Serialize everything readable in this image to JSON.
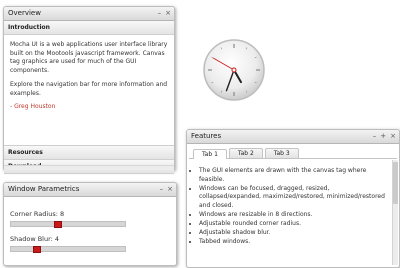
{
  "overview": {
    "title": "Overview",
    "minimize": "–",
    "close": "×",
    "section_intro": "Introduction",
    "para1": "Mocha UI is a web applications user interface library built on the Mootools javascript framework. Canvas tag graphics are used for much of the GUI components.",
    "para2": "Explore the navigation bar for more information and examples.",
    "signature": "- Greg Houston",
    "section_resources": "Resources",
    "section_download": "Download"
  },
  "window_params": {
    "title": "Window Parametrics",
    "minimize": "–",
    "close": "×",
    "corner_radius_label": "Corner Radius: 8",
    "corner_radius_value": 8,
    "shadow_blur_label": "Shadow Blur: 4",
    "shadow_blur_value": 4
  },
  "features": {
    "title": "Features",
    "minimize": "–",
    "maximize": "+",
    "close": "×",
    "tabs": [
      "Tab 1",
      "Tab 2",
      "Tab 3"
    ],
    "active_tab": "Tab 1",
    "items": [
      "The GUI elements are drawn with the canvas tag where feasible.",
      "Windows can be focused, dragged, resized, collapsed/expanded, maximized/restored, minimized/restored and closed.",
      "Windows are resizable in 8 directions.",
      "Adjustable rounded corner radius.",
      "Adjustable shadow blur.",
      "Tabbed windows."
    ]
  },
  "clock": {
    "hour_hand_angle_deg": 150,
    "minute_hand_angle_deg": 200,
    "second_hand_angle_deg": 300
  },
  "colors": {
    "accent_red": "#cc1a1a",
    "signature_red": "#c0392b"
  }
}
